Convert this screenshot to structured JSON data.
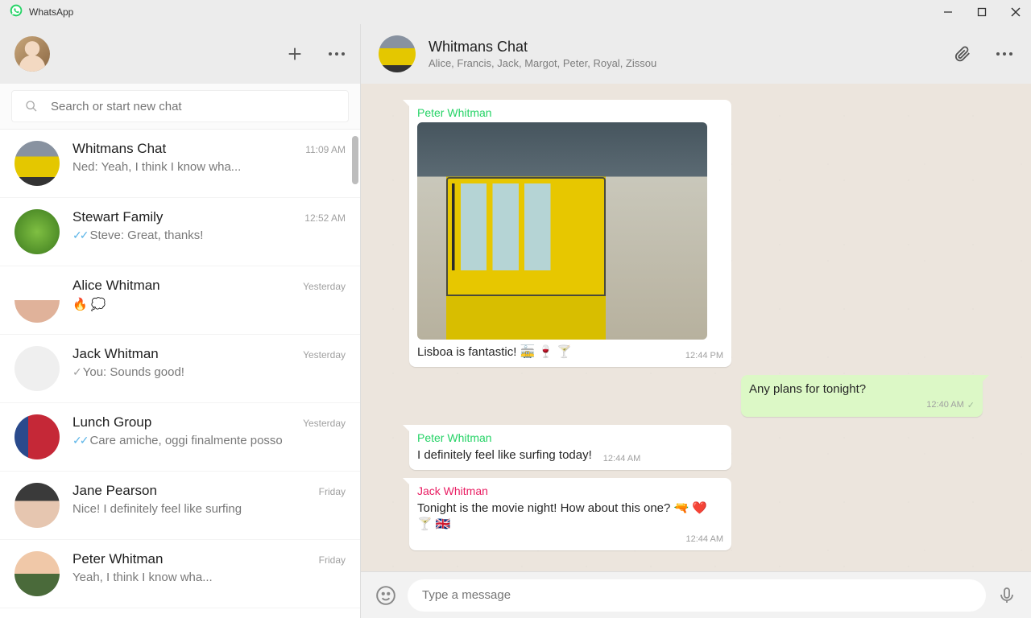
{
  "window": {
    "title": "WhatsApp"
  },
  "sidebar": {
    "search_placeholder": "Search or start new chat",
    "chats": [
      {
        "name": "Whitmans Chat",
        "time": "11:09 AM",
        "preview": "Ned: Yeah, I think I know wha...",
        "status": "none",
        "avatar": "av-tram"
      },
      {
        "name": "Stewart Family",
        "time": "12:52 AM",
        "preview": "Steve: Great, thanks!",
        "status": "read",
        "avatar": "av-green"
      },
      {
        "name": "Alice Whitman",
        "time": "Yesterday",
        "preview": "🔥 💭",
        "status": "none",
        "avatar": "av-alice"
      },
      {
        "name": "Jack Whitman",
        "time": "Yesterday",
        "preview": "You: Sounds good!",
        "status": "sent",
        "avatar": "av-jack"
      },
      {
        "name": "Lunch Group",
        "time": "Yesterday",
        "preview": "Care amiche, oggi finalmente posso",
        "status": "read",
        "avatar": "av-eat"
      },
      {
        "name": "Jane Pearson",
        "time": "Friday",
        "preview": "Nice! I definitely feel like surfing",
        "status": "none",
        "avatar": "av-jane"
      },
      {
        "name": "Peter Whitman",
        "time": "Friday",
        "preview": "Yeah, I think I know wha...",
        "status": "none",
        "avatar": "av-peter"
      }
    ]
  },
  "conversation": {
    "title": "Whitmans Chat",
    "members": "Alice, Francis, Jack, Margot, Peter, Royal, Zissou",
    "messages": [
      {
        "type": "media_in",
        "sender": "Peter Whitman",
        "sender_class": "peter",
        "text": "Lisboa is fantastic!  🚋 🍷 🍸",
        "time": "12:44 PM"
      },
      {
        "type": "out",
        "text": "Any plans for tonight?",
        "time": "12:40 AM",
        "status": "sent"
      },
      {
        "type": "in",
        "sender": "Peter Whitman",
        "sender_class": "peter",
        "text": "I definitely feel like surfing today!",
        "time": "12:44 AM"
      },
      {
        "type": "in",
        "sender": "Jack Whitman",
        "sender_class": "jack",
        "text": "Tonight is the movie night! How about this one?  🔫 ❤️ 🍸 🇬🇧",
        "time": "12:44 AM"
      }
    ],
    "composer_placeholder": "Type a message"
  }
}
